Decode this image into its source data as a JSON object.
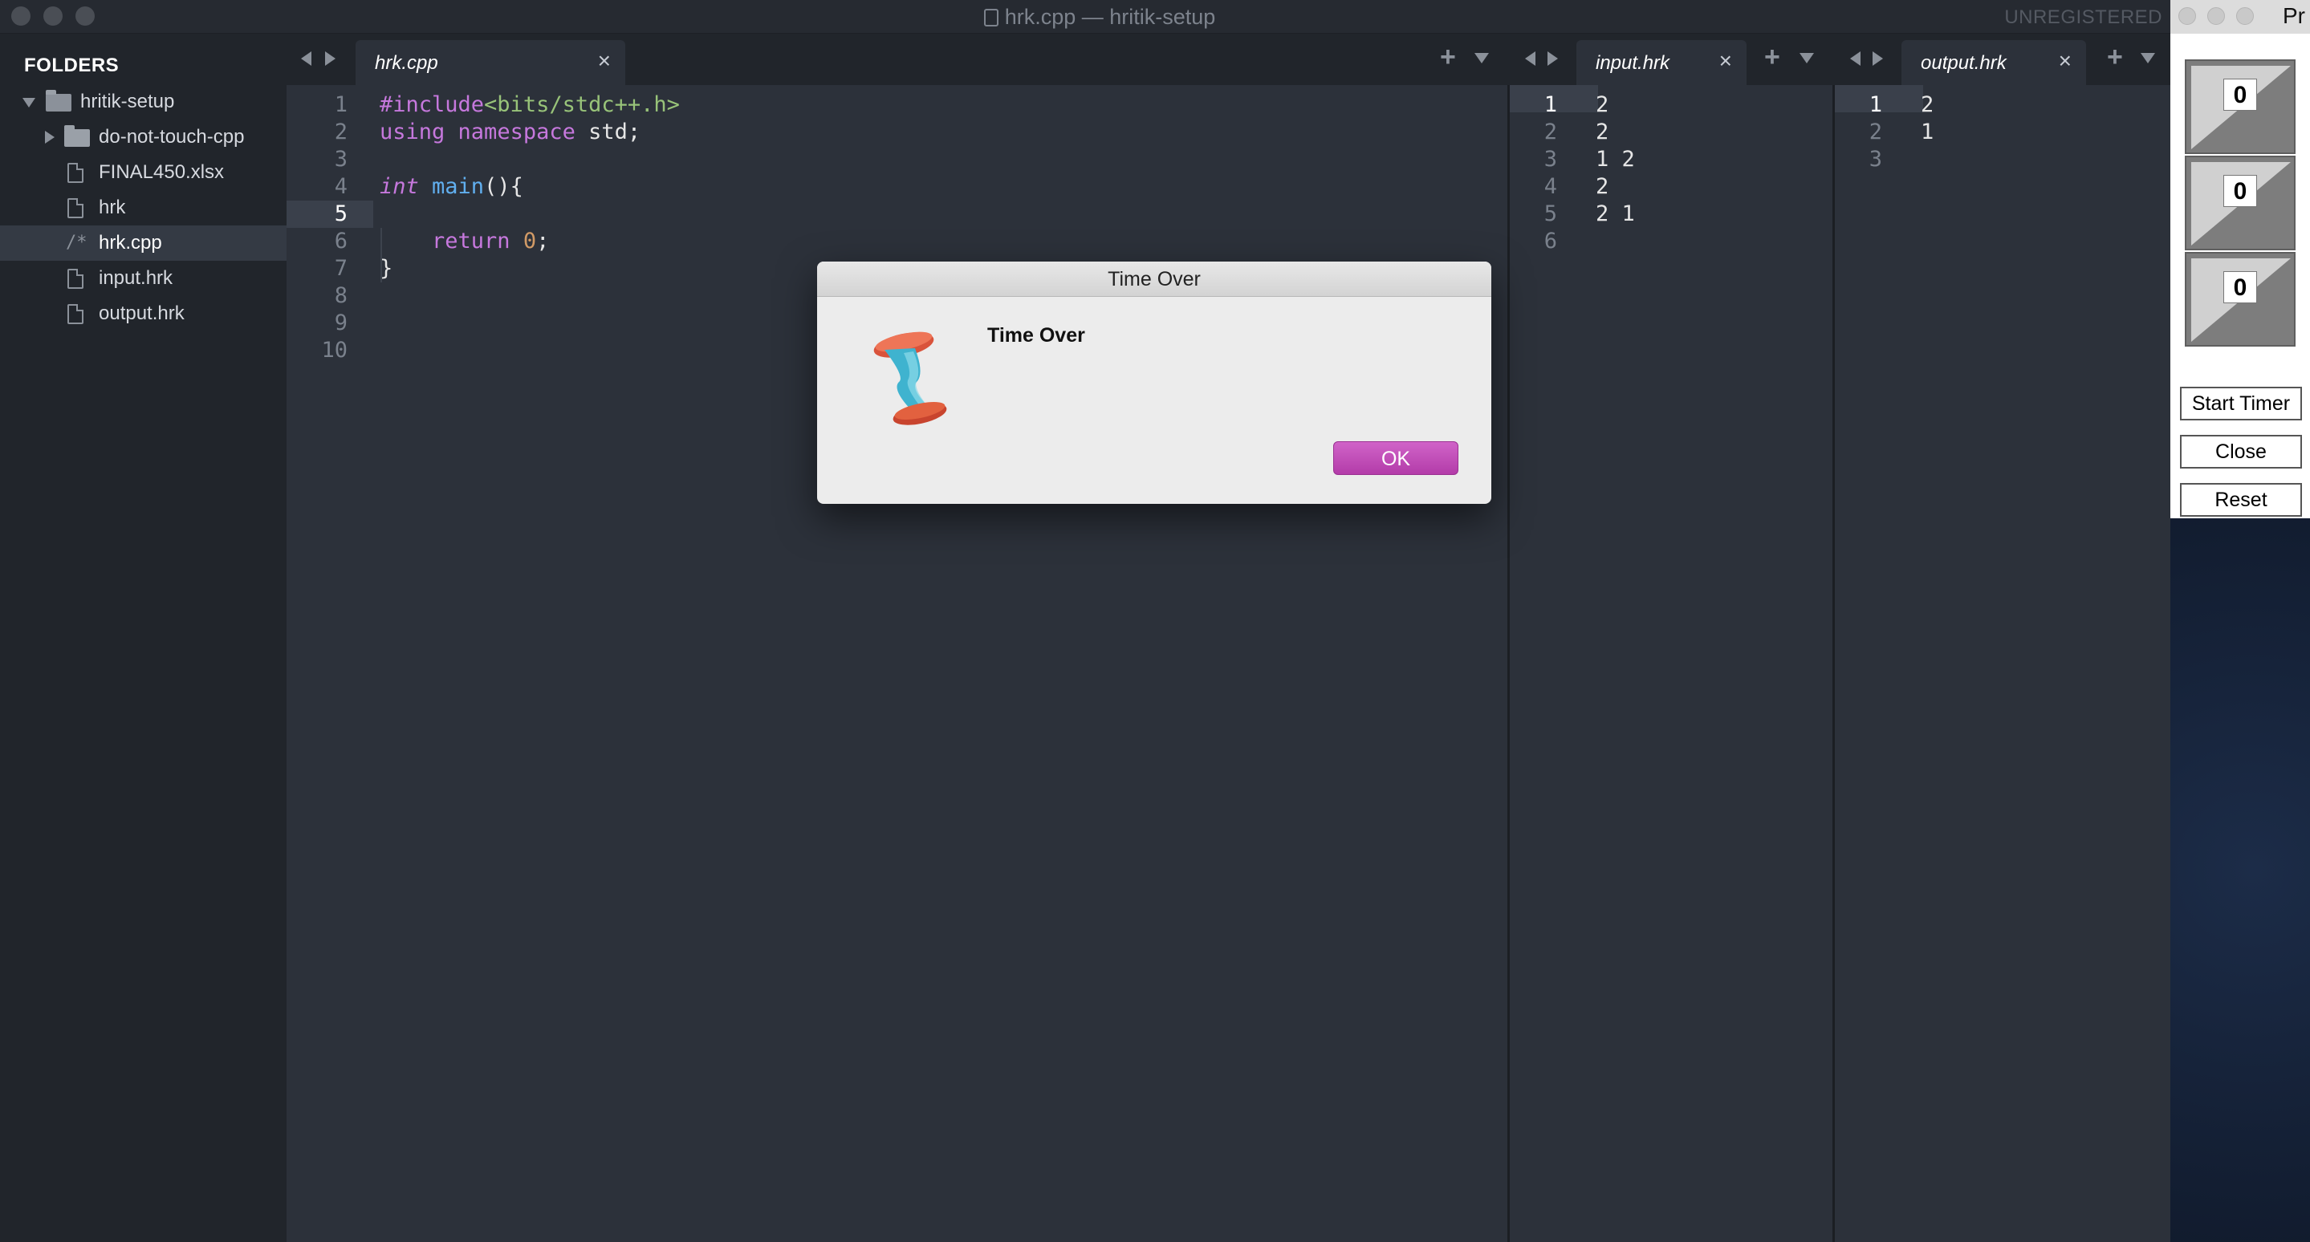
{
  "window": {
    "title": "hrk.cpp — hritik-setup",
    "unregistered": "UNREGISTERED"
  },
  "sidebar": {
    "heading": "FOLDERS",
    "root": "hritik-setup",
    "items": [
      {
        "label": "do-not-touch-cpp",
        "type": "folder"
      },
      {
        "label": "FINAL450.xlsx",
        "type": "file"
      },
      {
        "label": "hrk",
        "type": "file"
      },
      {
        "label": "hrk.cpp",
        "type": "cpp",
        "icon_text": "/*",
        "active": true
      },
      {
        "label": "input.hrk",
        "type": "file"
      },
      {
        "label": "output.hrk",
        "type": "file"
      }
    ]
  },
  "editor": {
    "tab": "hrk.cpp",
    "close_glyph": "×",
    "current_line": 5,
    "line_numbers": [
      "1",
      "2",
      "3",
      "4",
      "5",
      "6",
      "7",
      "8",
      "9",
      "10"
    ],
    "lines": [
      [
        {
          "t": "#include",
          "c": "pp"
        },
        {
          "t": "<bits/stdc++.h>",
          "c": "inc"
        }
      ],
      [
        {
          "t": "using ",
          "c": "kw"
        },
        {
          "t": "namespace ",
          "c": "kw"
        },
        {
          "t": "std;",
          "c": ""
        }
      ],
      [],
      [
        {
          "t": "int ",
          "c": "kwi"
        },
        {
          "t": "main",
          "c": "fn"
        },
        {
          "t": "(){",
          "c": ""
        }
      ],
      [],
      [
        {
          "t": "    return ",
          "c": "kw"
        },
        {
          "t": "0",
          "c": "num"
        },
        {
          "t": ";",
          "c": ""
        }
      ],
      [
        {
          "t": "}",
          "c": ""
        }
      ],
      [],
      [],
      []
    ]
  },
  "input_pane": {
    "tab": "input.hrk",
    "close_glyph": "×",
    "line_numbers": [
      "1",
      "2",
      "3",
      "4",
      "5",
      "6"
    ],
    "lines": [
      "2",
      "2",
      "1 2",
      "2",
      "2 1",
      ""
    ]
  },
  "output_pane": {
    "tab": "output.hrk",
    "close_glyph": "×",
    "line_numbers": [
      "1",
      "2",
      "3"
    ],
    "lines": [
      "2",
      "1",
      ""
    ]
  },
  "dialog": {
    "title": "Time Over",
    "message": "Time Over",
    "ok_label": "OK"
  },
  "timer_app": {
    "title": "Pr",
    "digits": [
      "0",
      "0",
      "0"
    ],
    "buttons": {
      "start": "Start Timer",
      "close": "Close",
      "reset": "Reset"
    }
  },
  "colors": {
    "accent_button": "#c04cb6",
    "editor_bg": "#2c313a",
    "sidebar_bg": "#21252b"
  }
}
